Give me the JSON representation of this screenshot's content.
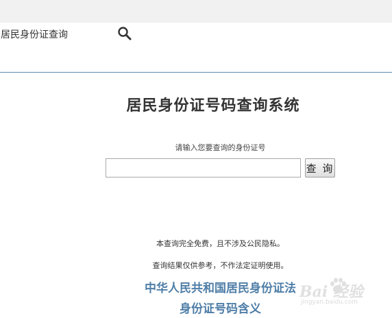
{
  "header": {
    "site_title": "居民身份证查询"
  },
  "main": {
    "title": "居民身份证号码查询系统",
    "prompt": "请输入您要查询的身份证号",
    "input_value": "",
    "input_placeholder": "",
    "query_button_label": "查 询"
  },
  "notices": {
    "line1": "本查询完全免费，且不涉及公民隐私。",
    "line2": "查询结果仅供参考，不作法定证明使用。"
  },
  "links": {
    "law": "中华人民共和国居民身份证法",
    "meaning": "身份证号码含义"
  },
  "watermark": {
    "logo_text": "Bai 经验",
    "url": "jingyan.baidu.com"
  },
  "colors": {
    "link": "#4f7ea7",
    "header_rule": "#5b8bb0",
    "topbar": "#f1f1f1"
  }
}
